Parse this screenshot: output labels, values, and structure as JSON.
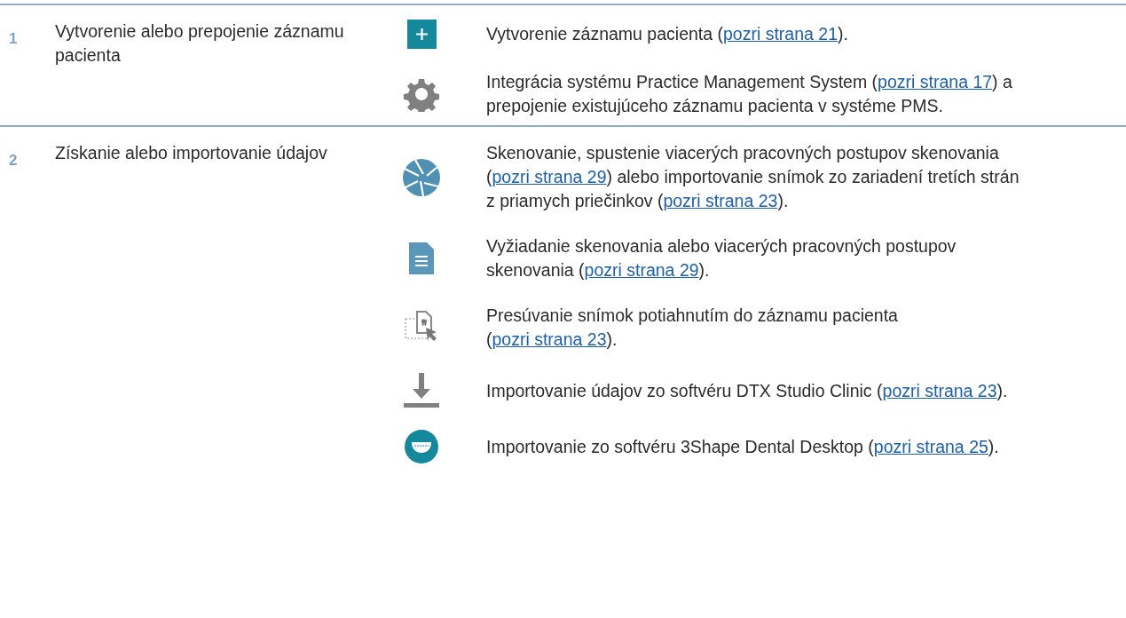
{
  "rows": [
    {
      "number": "1",
      "label": "Vytvorenie alebo prepojenie záznamu pacienta",
      "items": [
        {
          "kind": "plus",
          "parts": [
            {
              "kind": "text",
              "text": "Vytvorenie záznamu pacienta ("
            },
            {
              "kind": "link",
              "text": "pozri strana 21"
            },
            {
              "kind": "text",
              "text": ")."
            }
          ]
        },
        {
          "kind": "gear",
          "parts": [
            {
              "kind": "text",
              "text": "Integrácia systému Practice Management System ("
            },
            {
              "kind": "link",
              "text": "pozri strana 17"
            },
            {
              "kind": "text",
              "text": ") a prepojenie existujúceho záznamu pacienta v systéme PMS."
            }
          ]
        }
      ]
    },
    {
      "number": "2",
      "label": "Získanie alebo importovanie údajov",
      "items": [
        {
          "kind": "aperture",
          "parts": [
            {
              "kind": "text",
              "text": "Skenovanie, spustenie viacerých pracovných postupov skenovania ("
            },
            {
              "kind": "link",
              "text": "pozri strana 29"
            },
            {
              "kind": "text",
              "text": ") alebo importovanie snímok zo zariadení tretích strán z priamych priečinkov ("
            },
            {
              "kind": "link",
              "text": "pozri strana 23"
            },
            {
              "kind": "text",
              "text": ")."
            }
          ]
        },
        {
          "kind": "document",
          "parts": [
            {
              "kind": "text",
              "text": "Vyžiadanie skenovania alebo viacerých pracovných postupov skenovania ("
            },
            {
              "kind": "link",
              "text": "pozri strana 29"
            },
            {
              "kind": "text",
              "text": ")."
            }
          ]
        },
        {
          "kind": "drag",
          "parts": [
            {
              "kind": "text",
              "text": "Presúvanie snímok potiahnutím do záznamu pacienta ("
            },
            {
              "kind": "link",
              "text": "pozri strana 23"
            },
            {
              "kind": "text",
              "text": ")."
            }
          ]
        },
        {
          "kind": "download",
          "parts": [
            {
              "kind": "text",
              "text": "Importovanie údajov zo softvéru DTX Studio Clinic ("
            },
            {
              "kind": "link",
              "text": "pozri strana 23"
            },
            {
              "kind": "text",
              "text": ")."
            }
          ]
        },
        {
          "kind": "dental",
          "parts": [
            {
              "kind": "text",
              "text": "Importovanie zo softvéru 3Shape Dental Desktop ("
            },
            {
              "kind": "link",
              "text": "pozri strana 25"
            },
            {
              "kind": "text",
              "text": ")."
            }
          ]
        }
      ]
    }
  ]
}
